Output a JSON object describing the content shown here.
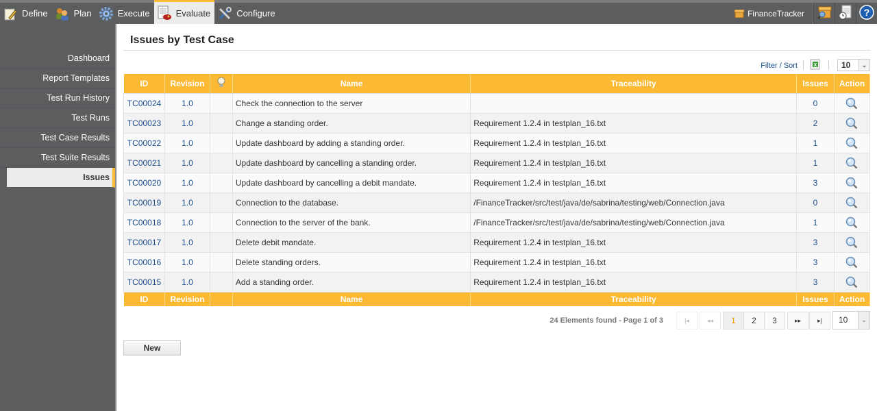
{
  "topnav": {
    "items": [
      {
        "label": "Define",
        "icon": "notepad-pencil-icon"
      },
      {
        "label": "Plan",
        "icon": "users-icon"
      },
      {
        "label": "Execute",
        "icon": "gear-icon"
      },
      {
        "label": "Evaluate",
        "icon": "report-chart-icon",
        "active": true
      },
      {
        "label": "Configure",
        "icon": "tools-icon"
      }
    ],
    "project": "FinanceTracker",
    "right_icons": [
      "project-search-icon",
      "report-clock-icon",
      "help-icon"
    ]
  },
  "sidebar": {
    "items": [
      {
        "label": "Dashboard"
      },
      {
        "label": "Report Templates"
      },
      {
        "label": "Test Run History"
      },
      {
        "label": "Test Runs"
      },
      {
        "label": "Test Case Results"
      },
      {
        "label": "Test Suite Results"
      },
      {
        "label": "Issues",
        "active": true
      }
    ]
  },
  "main": {
    "title": "Issues by Test Case",
    "filter_sort": "Filter / Sort",
    "page_size_top": "10",
    "columns": [
      "ID",
      "Revision",
      "",
      "Name",
      "Traceability",
      "Issues",
      "Action"
    ],
    "rows": [
      {
        "id": "TC00024",
        "revision": "1.0",
        "name": "Check the connection to the server",
        "traceability": "",
        "issues": "0"
      },
      {
        "id": "TC00023",
        "revision": "1.0",
        "name": "Change a standing order.",
        "traceability": "Requirement 1.2.4 in testplan_16.txt",
        "issues": "2"
      },
      {
        "id": "TC00022",
        "revision": "1.0",
        "name": "Update dashboard by adding a standing order.",
        "traceability": "Requirement 1.2.4 in testplan_16.txt",
        "issues": "1"
      },
      {
        "id": "TC00021",
        "revision": "1.0",
        "name": "Update dashboard by cancelling a standing order.",
        "traceability": "Requirement 1.2.4 in testplan_16.txt",
        "issues": "1"
      },
      {
        "id": "TC00020",
        "revision": "1.0",
        "name": "Update dashboard by cancelling a debit mandate.",
        "traceability": "Requirement 1.2.4 in testplan_16.txt",
        "issues": "3"
      },
      {
        "id": "TC00019",
        "revision": "1.0",
        "name": "Connection to the database.",
        "traceability": "/FinanceTracker/src/test/java/de/sabrina/testing/web/Connection.java",
        "issues": "0"
      },
      {
        "id": "TC00018",
        "revision": "1.0",
        "name": "Connection to the server of the bank.",
        "traceability": "/FinanceTracker/src/test/java/de/sabrina/testing/web/Connection.java",
        "issues": "1"
      },
      {
        "id": "TC00017",
        "revision": "1.0",
        "name": "Delete debit mandate.",
        "traceability": "Requirement 1.2.4 in testplan_16.txt",
        "issues": "3"
      },
      {
        "id": "TC00016",
        "revision": "1.0",
        "name": "Delete standing orders.",
        "traceability": "Requirement 1.2.4 in testplan_16.txt",
        "issues": "3"
      },
      {
        "id": "TC00015",
        "revision": "1.0",
        "name": "Add a standing order.",
        "traceability": "Requirement 1.2.4 in testplan_16.txt",
        "issues": "3"
      }
    ],
    "pager": {
      "summary": "24 Elements found - Page 1 of 3",
      "first": "|◂",
      "prev": "◂◂",
      "pages": [
        "1",
        "2",
        "3"
      ],
      "current": "1",
      "next": "▸▸",
      "last": "▸|",
      "page_size": "10"
    },
    "new_button": "New"
  },
  "colors": {
    "accent": "#fbb934",
    "link": "#1b4d8c",
    "chrome": "#5b5d5f"
  }
}
